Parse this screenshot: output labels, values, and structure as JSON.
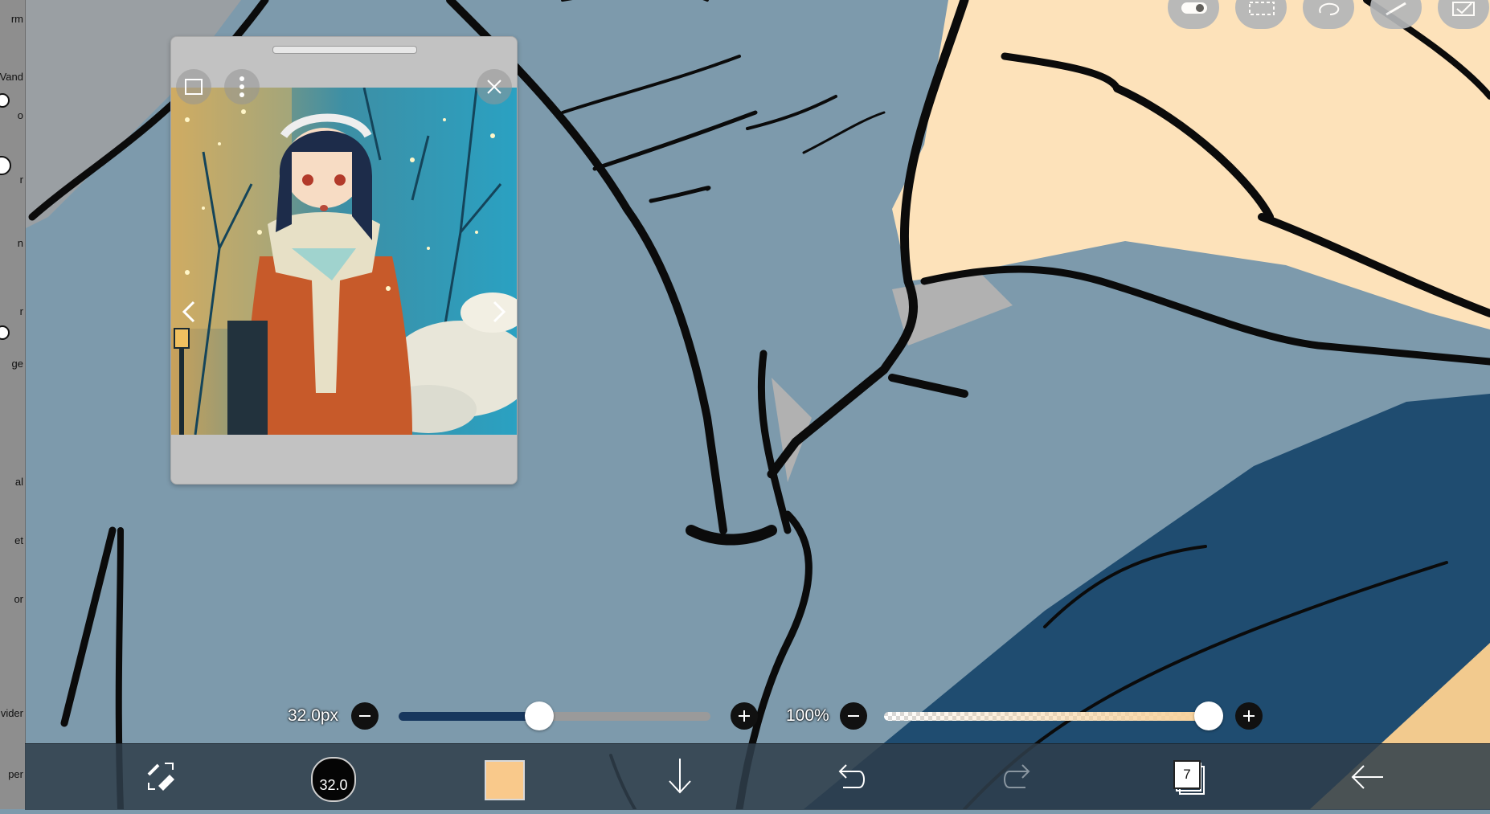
{
  "left_tools": {
    "labels": [
      "rm",
      "Vand",
      "o",
      "r",
      "n",
      "r",
      "ge",
      "al",
      "et",
      "or",
      "vider",
      "per"
    ]
  },
  "top_icons": [
    "toggle-icon",
    "selection-icon",
    "lasso-icon",
    "ruler-icon",
    "checkbox-icon"
  ],
  "reference_window": {
    "image_description_icon": "reference-image"
  },
  "sliders": {
    "brush_size_label": "32.0px",
    "brush_size_fraction": 0.45,
    "opacity_label": "100%",
    "opacity_fraction": 1.0
  },
  "toolbar": {
    "brush_size_value": "32.0",
    "color_hex": "#f9c98b",
    "layers_count": "7"
  },
  "colors": {
    "canvas_blue": "#7d9aac",
    "skin": "#fde2ba",
    "dark_blue": "#1f4c70",
    "toolbar_bg": "#2f3e4a"
  }
}
